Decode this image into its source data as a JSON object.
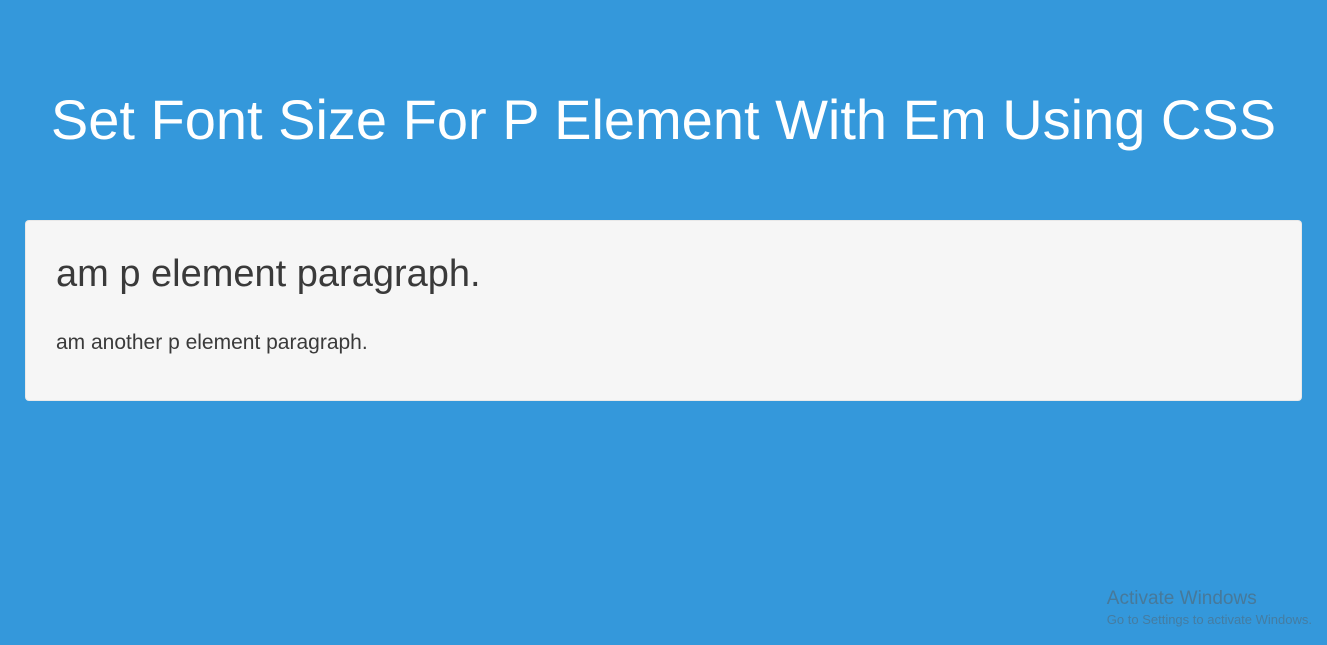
{
  "header": {
    "title": "Set Font Size For P Element With Em Using CSS"
  },
  "content": {
    "paragraph1": "am p element paragraph.",
    "paragraph2": "am another p element paragraph."
  },
  "watermark": {
    "title": "Activate Windows",
    "subtitle": "Go to Settings to activate Windows."
  }
}
